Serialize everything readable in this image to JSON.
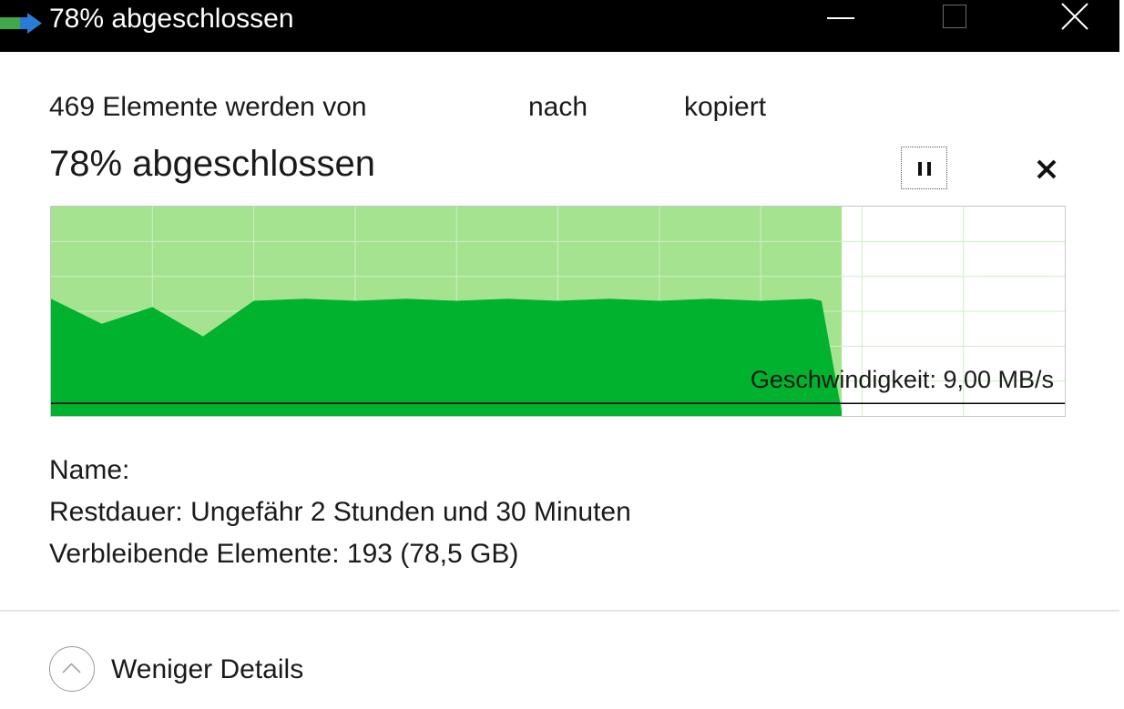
{
  "window": {
    "title": "78% abgeschlossen",
    "icons": [
      "copy-icon",
      "minimize-icon",
      "maximize-icon",
      "close-icon"
    ]
  },
  "summary": {
    "prefix": "469 Elemente werden von",
    "nach": "nach",
    "kopiert": "kopiert"
  },
  "progress": {
    "heading": "78% abgeschlossen",
    "percent": 78
  },
  "controls": {
    "pause_icon": "pause-icon",
    "cancel_icon": "cancel-icon"
  },
  "chart_data": {
    "type": "area",
    "x": [
      0,
      0.05,
      0.1,
      0.15,
      0.2,
      0.25,
      0.3,
      0.35,
      0.4,
      0.45,
      0.5,
      0.55,
      0.6,
      0.65,
      0.7,
      0.75,
      0.76,
      0.78
    ],
    "values": [
      0.56,
      0.44,
      0.52,
      0.38,
      0.55,
      0.56,
      0.55,
      0.56,
      0.55,
      0.56,
      0.55,
      0.56,
      0.55,
      0.56,
      0.55,
      0.56,
      0.55,
      0.02
    ],
    "current_line": 0.06,
    "progress_fraction": 0.78,
    "grid": true,
    "speed_label": "Geschwindigkeit: 9,00 MB/s",
    "colors": {
      "fill": "#00b22d",
      "done_bg": "#a6e391",
      "grid": "#ccefc4",
      "line": "#000000"
    }
  },
  "details": {
    "name": "Name:",
    "remaining_time": "Restdauer: Ungefähr 2 Stunden und 30 Minuten",
    "remaining_items": "Verbleibende Elemente: 193 (78,5 GB)"
  },
  "footer": {
    "toggle_label": "Weniger Details",
    "icon": "chevron-up-icon"
  }
}
